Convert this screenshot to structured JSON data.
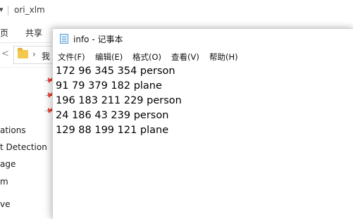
{
  "explorer": {
    "title": "ori_xlm",
    "ribbon_tabs": [
      "页",
      "共享"
    ],
    "address_text": "我",
    "nav_items": [
      "ations",
      "t Detection",
      "age",
      "m",
      "ve"
    ]
  },
  "notepad": {
    "title": "info - 记事本",
    "menu": [
      "文件(F)",
      "编辑(E)",
      "格式(O)",
      "查看(V)",
      "帮助(H)"
    ],
    "lines": [
      "172 96 345 354 person",
      "91 79 379 182 plane",
      "196 183 211 229 person",
      "24 186 43 239 person",
      "129 88 199 121 plane"
    ]
  }
}
